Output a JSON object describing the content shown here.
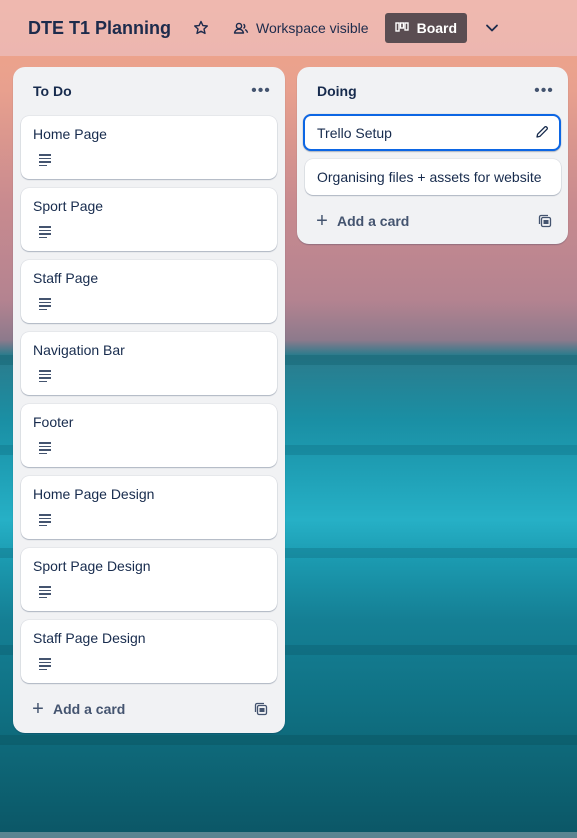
{
  "header": {
    "title": "DTE T1 Planning",
    "visibility_label": "Workspace visible",
    "view_label": "Board"
  },
  "lists": [
    {
      "title": "To Do",
      "cards": [
        {
          "title": "Home Page",
          "has_description": true
        },
        {
          "title": "Sport Page",
          "has_description": true
        },
        {
          "title": "Staff Page",
          "has_description": true
        },
        {
          "title": "Navigation Bar",
          "has_description": true
        },
        {
          "title": "Footer",
          "has_description": true
        },
        {
          "title": "Home Page Design",
          "has_description": true
        },
        {
          "title": "Sport Page Design",
          "has_description": true
        },
        {
          "title": "Staff Page Design",
          "has_description": true
        }
      ],
      "add_label": "Add a card"
    },
    {
      "title": "Doing",
      "cards": [
        {
          "title": "Trello Setup",
          "selected": true
        },
        {
          "title": "Organising files + assets for website"
        }
      ],
      "add_label": "Add a card"
    }
  ],
  "icons": {
    "star": "star-icon",
    "visibility": "workspace-visibility-icon",
    "board": "board-icon",
    "chevron": "chevron-down-icon",
    "more": "more-dots-icon",
    "description": "description-icon",
    "edit": "pencil-icon",
    "add": "plus-icon",
    "template": "card-template-icon"
  },
  "colors": {
    "accent": "#0c66e4",
    "board_button": "#5a4d52",
    "list_bg": "#f1f2f4",
    "text": "#172b4d"
  }
}
